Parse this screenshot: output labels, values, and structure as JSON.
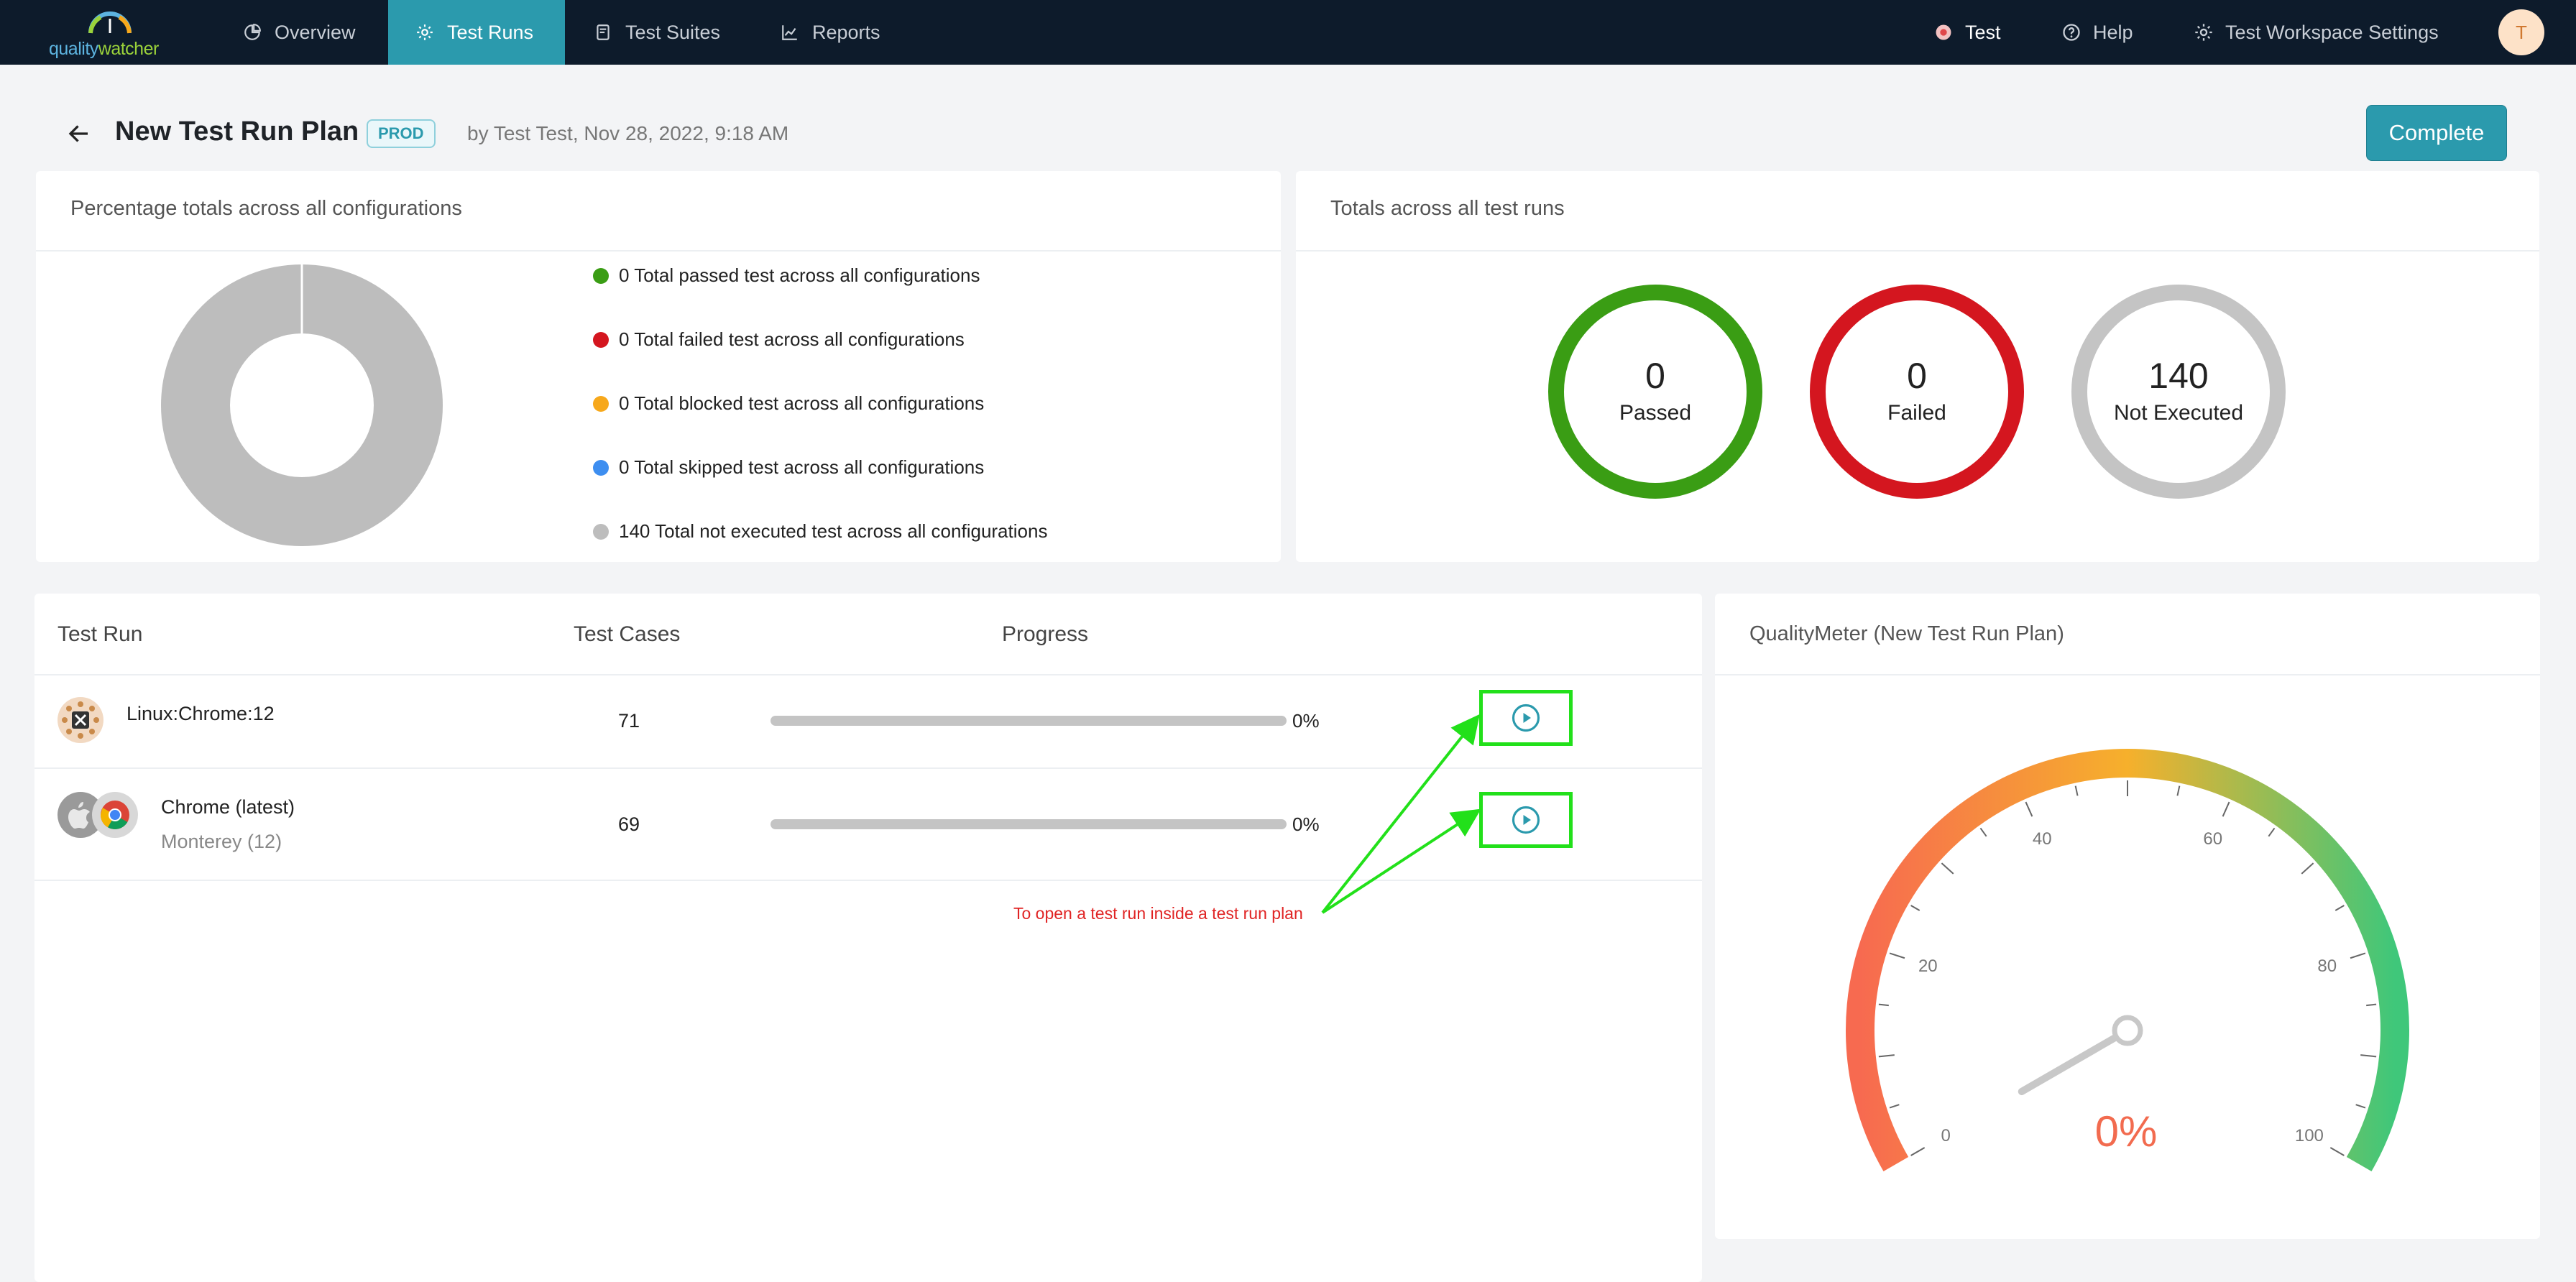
{
  "app": {
    "logo_quality": "quality",
    "logo_watcher": "watcher"
  },
  "nav": {
    "tabs": [
      {
        "label": "Overview",
        "icon": "pie-chart-icon"
      },
      {
        "label": "Test Runs",
        "icon": "gear-icon",
        "active": true
      },
      {
        "label": "Test Suites",
        "icon": "document-icon"
      },
      {
        "label": "Reports",
        "icon": "line-chart-icon"
      }
    ],
    "workspace": "Test",
    "help": "Help",
    "settings": "Test Workspace Settings",
    "avatar": "T"
  },
  "header": {
    "title": "New Test Run Plan",
    "env_badge": "PROD",
    "byline": "by Test Test, Nov 28, 2022, 9:18 AM",
    "complete_label": "Complete"
  },
  "percentage_card": {
    "title": "Percentage totals across all configurations",
    "legend": [
      {
        "label": "0 Total passed test across all configurations",
        "color": "#3a9d14"
      },
      {
        "label": "0 Total failed test across all configurations",
        "color": "#d4161f"
      },
      {
        "label": "0 Total blocked test across all configurations",
        "color": "#f7a81b"
      },
      {
        "label": "0 Total skipped test across all configurations",
        "color": "#3d8ef0"
      },
      {
        "label": "140 Total not executed test across all configurations",
        "color": "#bdbdbd"
      }
    ]
  },
  "totals_card": {
    "title": "Totals across all test runs",
    "stats": [
      {
        "value": "0",
        "label": "Passed",
        "color": "#3a9d14"
      },
      {
        "value": "0",
        "label": "Failed",
        "color": "#d4161f"
      },
      {
        "value": "140",
        "label": "Not Executed",
        "color": "#c4c4c4"
      }
    ]
  },
  "runs_table": {
    "headers": {
      "run": "Test Run",
      "cases": "Test Cases",
      "progress": "Progress"
    },
    "rows": [
      {
        "name": "Linux:Chrome:12",
        "sub": "",
        "cases": "71",
        "progress": 0,
        "progress_label": "0%"
      },
      {
        "name": "Chrome (latest)",
        "sub": "Monterey (12)",
        "cases": "69",
        "progress": 0,
        "progress_label": "0%"
      }
    ],
    "annotation": "To open a test run inside a test run plan"
  },
  "quality_meter": {
    "title": "QualityMeter (New Test Run Plan)",
    "value": 0,
    "value_label": "0%",
    "tick_labels": [
      "0",
      "20",
      "40",
      "60",
      "80",
      "100"
    ]
  },
  "chart_data": {
    "type": "pie",
    "title": "Percentage totals across all configurations",
    "categories": [
      "passed",
      "failed",
      "blocked",
      "skipped",
      "not executed"
    ],
    "values": [
      0,
      0,
      0,
      0,
      140
    ]
  }
}
